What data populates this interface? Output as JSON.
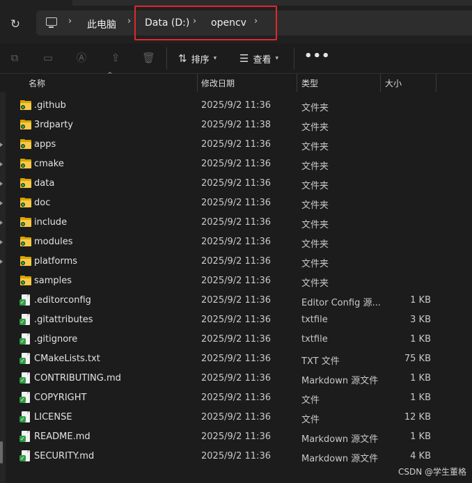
{
  "address": {
    "crumbs": [
      "此电脑",
      "Data (D:)",
      "opencv"
    ],
    "refresh_icon": "refresh-icon",
    "pc_icon": "computer-icon",
    "highlight_color": "#e0282d"
  },
  "toolbar": {
    "sort_label": "排序",
    "view_label": "查看",
    "more_label": "•••",
    "disabled_icons": [
      "copy-icon",
      "paste-icon",
      "rename-icon",
      "share-icon",
      "delete-icon"
    ]
  },
  "columns": {
    "name": "名称",
    "date": "修改日期",
    "type": "类型",
    "size": "大小"
  },
  "files": [
    {
      "name": ".github",
      "date": "2025/9/2 11:36",
      "type": "文件夹",
      "size": "",
      "kind": "folder"
    },
    {
      "name": "3rdparty",
      "date": "2025/9/2 11:38",
      "type": "文件夹",
      "size": "",
      "kind": "folder"
    },
    {
      "name": "apps",
      "date": "2025/9/2 11:36",
      "type": "文件夹",
      "size": "",
      "kind": "folder"
    },
    {
      "name": "cmake",
      "date": "2025/9/2 11:36",
      "type": "文件夹",
      "size": "",
      "kind": "folder"
    },
    {
      "name": "data",
      "date": "2025/9/2 11:36",
      "type": "文件夹",
      "size": "",
      "kind": "folder"
    },
    {
      "name": "doc",
      "date": "2025/9/2 11:36",
      "type": "文件夹",
      "size": "",
      "kind": "folder"
    },
    {
      "name": "include",
      "date": "2025/9/2 11:36",
      "type": "文件夹",
      "size": "",
      "kind": "folder"
    },
    {
      "name": "modules",
      "date": "2025/9/2 11:36",
      "type": "文件夹",
      "size": "",
      "kind": "folder"
    },
    {
      "name": "platforms",
      "date": "2025/9/2 11:36",
      "type": "文件夹",
      "size": "",
      "kind": "folder"
    },
    {
      "name": "samples",
      "date": "2025/9/2 11:36",
      "type": "文件夹",
      "size": "",
      "kind": "folder"
    },
    {
      "name": ".editorconfig",
      "date": "2025/9/2 11:36",
      "type": "Editor Config 源...",
      "size": "1 KB",
      "kind": "file"
    },
    {
      "name": ".gitattributes",
      "date": "2025/9/2 11:36",
      "type": "txtfile",
      "size": "3 KB",
      "kind": "file"
    },
    {
      "name": ".gitignore",
      "date": "2025/9/2 11:36",
      "type": "txtfile",
      "size": "1 KB",
      "kind": "file"
    },
    {
      "name": "CMakeLists.txt",
      "date": "2025/9/2 11:36",
      "type": "TXT 文件",
      "size": "75 KB",
      "kind": "file"
    },
    {
      "name": "CONTRIBUTING.md",
      "date": "2025/9/2 11:36",
      "type": "Markdown 源文件",
      "size": "1 KB",
      "kind": "file"
    },
    {
      "name": "COPYRIGHT",
      "date": "2025/9/2 11:36",
      "type": "文件",
      "size": "1 KB",
      "kind": "file"
    },
    {
      "name": "LICENSE",
      "date": "2025/9/2 11:36",
      "type": "文件",
      "size": "12 KB",
      "kind": "file"
    },
    {
      "name": "README.md",
      "date": "2025/9/2 11:36",
      "type": "Markdown 源文件",
      "size": "1 KB",
      "kind": "file"
    },
    {
      "name": "SECURITY.md",
      "date": "2025/9/2 11:36",
      "type": "Markdown 源文件",
      "size": "4 KB",
      "kind": "file"
    }
  ],
  "watermark": "CSDN @学生董格"
}
